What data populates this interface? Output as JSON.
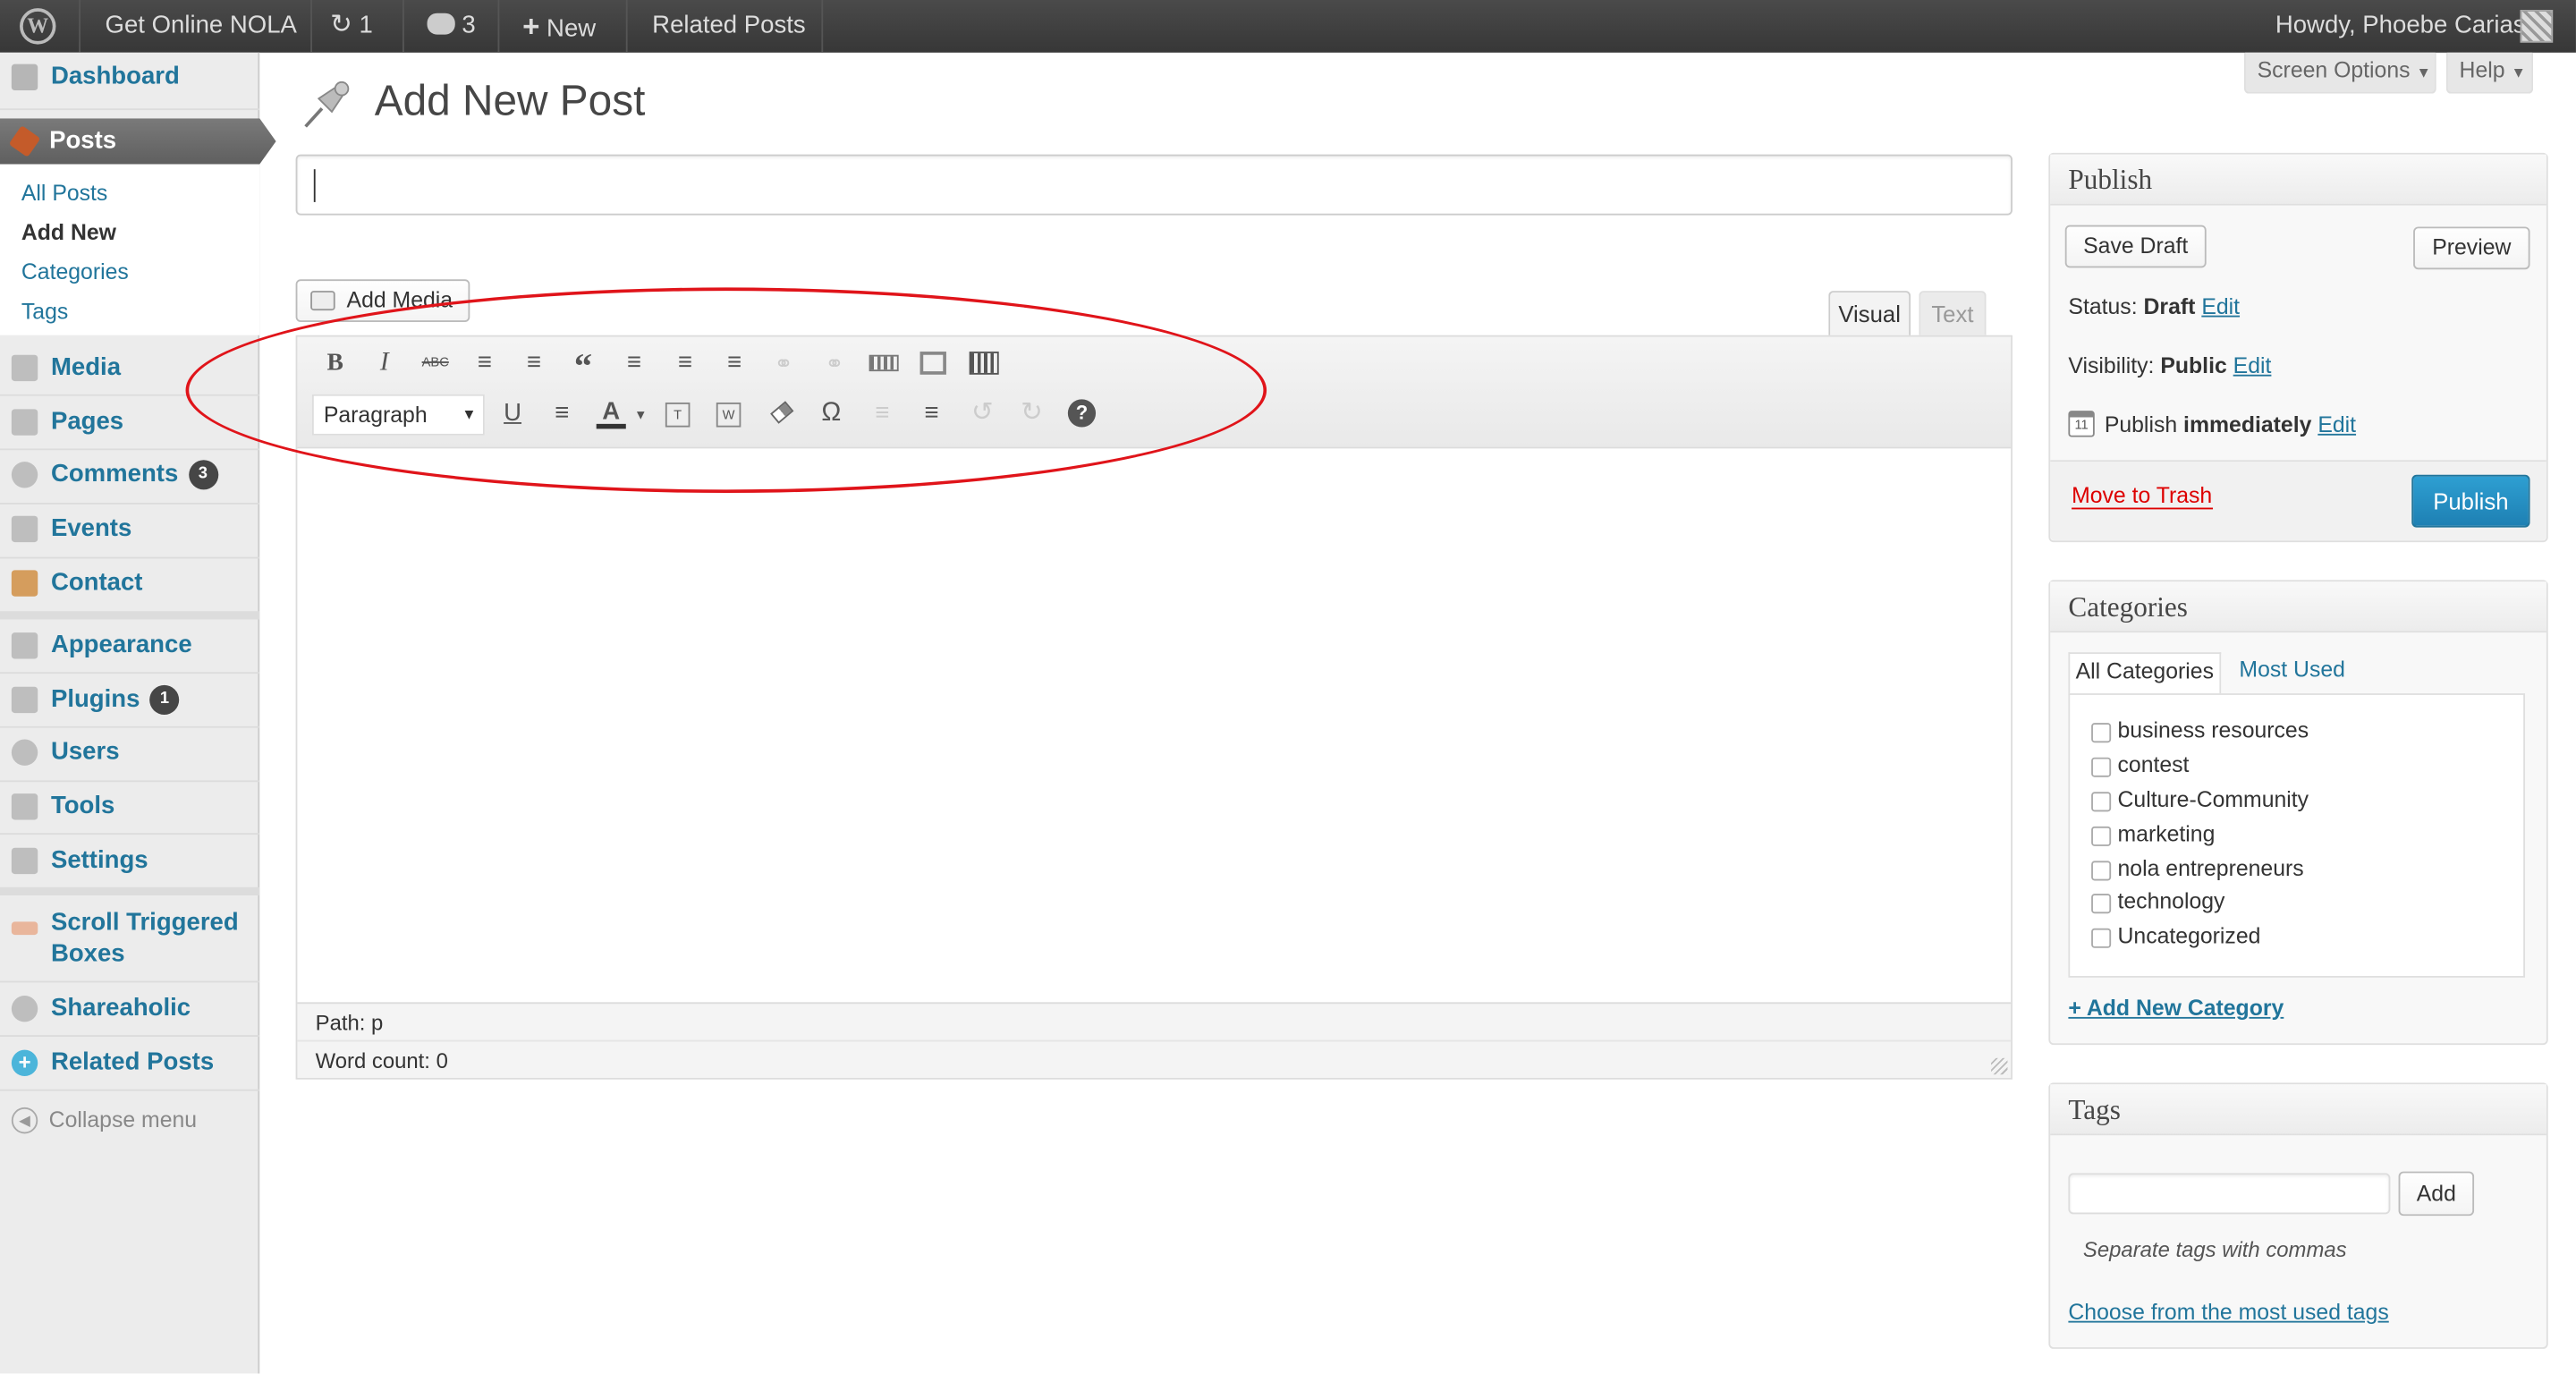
{
  "adminbar": {
    "site_name": "Get Online NOLA",
    "updates_count": "1",
    "comments_count": "3",
    "new_label": "New",
    "related_posts": "Related Posts",
    "howdy": "Howdy, Phoebe Carias"
  },
  "sidebar": {
    "dashboard": "Dashboard",
    "posts": "Posts",
    "posts_sub": [
      "All Posts",
      "Add New",
      "Categories",
      "Tags"
    ],
    "media": "Media",
    "pages": "Pages",
    "comments": "Comments",
    "comments_badge": "3",
    "events": "Events",
    "contact": "Contact",
    "appearance": "Appearance",
    "plugins": "Plugins",
    "plugins_badge": "1",
    "users": "Users",
    "tools": "Tools",
    "settings": "Settings",
    "scroll_line1": "Scroll Triggered",
    "scroll_line2": "Boxes",
    "shareaholic": "Shareaholic",
    "related_posts": "Related Posts",
    "collapse": "Collapse menu"
  },
  "header": {
    "title": "Add New Post",
    "screen_options": "Screen Options",
    "help": "Help"
  },
  "editor": {
    "title_value": "",
    "add_media": "Add Media",
    "tab_visual": "Visual",
    "tab_text": "Text",
    "format_select": "Paragraph",
    "path": "Path: p",
    "word_count": "Word count: 0"
  },
  "publish": {
    "heading": "Publish",
    "save_draft": "Save Draft",
    "preview": "Preview",
    "status_label": "Status:",
    "status_value": "Draft",
    "visibility_label": "Visibility:",
    "visibility_value": "Public",
    "publish_label": "Publish",
    "publish_value": "immediately",
    "edit": "Edit",
    "calendar_day": "11",
    "trash": "Move to Trash",
    "publish_button": "Publish"
  },
  "categories": {
    "heading": "Categories",
    "tab_all": "All Categories",
    "tab_most": "Most Used",
    "items": [
      "business resources",
      "contest",
      "Culture-Community",
      "marketing",
      "nola entrepreneurs",
      "technology",
      "Uncategorized"
    ],
    "add_new": "+ Add New Category"
  },
  "tags": {
    "heading": "Tags",
    "input_value": "",
    "add_button": "Add",
    "hint": "Separate tags with commas",
    "choose": "Choose from the most used tags"
  },
  "colors": {
    "link": "#21759b",
    "publish_button": "#2a95c5",
    "annotation": "#e0141a",
    "trash": "#d00"
  }
}
